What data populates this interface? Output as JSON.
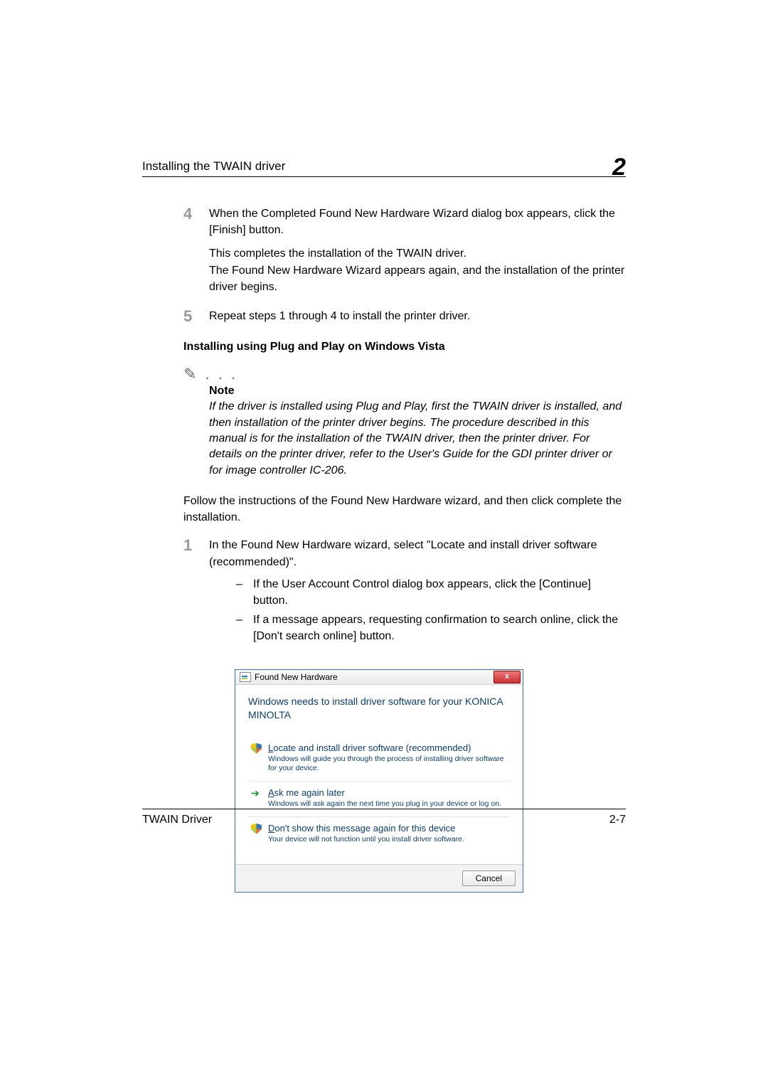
{
  "header": {
    "title": "Installing the TWAIN driver",
    "chapter": "2"
  },
  "step4": {
    "num": "4",
    "text": "When the Completed Found New Hardware Wizard dialog box appears, click the [Finish] button.",
    "sub1": "This completes the installation of the TWAIN driver.",
    "sub2": "The Found New Hardware Wizard appears again, and the installation of the printer driver begins."
  },
  "step5": {
    "num": "5",
    "text": "Repeat steps 1 through 4 to install the printer driver."
  },
  "section_heading": "Installing using Plug and Play on Windows Vista",
  "note": {
    "label": "Note",
    "text": "If the driver is installed using Plug and Play, first the TWAIN driver is installed, and then installation of the printer driver begins. The procedure described in this manual is for the installation of the TWAIN driver, then the printer driver. For details on the printer driver, refer to the User's Guide for the GDI printer driver or for image controller IC-206."
  },
  "intro_para": "Follow the instructions of the Found New Hardware wizard, and then click complete the installation.",
  "step1": {
    "num": "1",
    "text": "In the Found New Hardware wizard, select \"Locate and install driver software (recommended)\".",
    "sub_a": "If the User Account Control dialog box appears, click the [Continue] button.",
    "sub_b": "If a message appears, requesting confirmation to search online, click the [Don't search online] button."
  },
  "dialog": {
    "title": "Found New Hardware",
    "close": "x",
    "heading_a": "Windows needs to install driver software for your KONICA",
    "heading_b": "MINOLTA",
    "opt1_title_pre": "L",
    "opt1_title_rest": "ocate and install driver software (recommended)",
    "opt1_desc": "Windows will guide you through the process of installing driver software for your device.",
    "opt2_title_pre": "A",
    "opt2_title_rest": "sk me again later",
    "opt2_desc": "Windows will ask again the next time you plug in your device or log on.",
    "opt3_title_pre": "D",
    "opt3_title_rest": "on't show this message again for this device",
    "opt3_desc": "Your device will not function until you install driver software.",
    "cancel": "Cancel"
  },
  "footer": {
    "left": "TWAIN Driver",
    "right": "2-7"
  }
}
